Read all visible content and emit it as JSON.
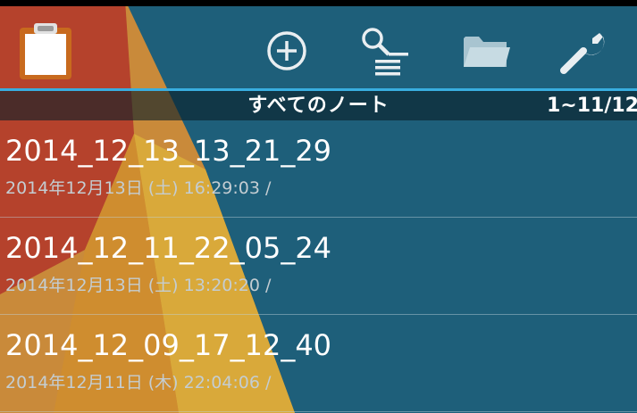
{
  "header": {
    "toolbar": [
      {
        "id": "add",
        "icon": "plus-circle-icon"
      },
      {
        "id": "search",
        "icon": "search-list-icon"
      },
      {
        "id": "folder",
        "icon": "folder-icon"
      },
      {
        "id": "settings",
        "icon": "wrench-icon"
      }
    ],
    "app_icon": "clipboard-icon"
  },
  "subbar": {
    "title": "すべてのノート",
    "count": "1~11/12"
  },
  "notes": [
    {
      "title": "2014_12_13_13_21_29",
      "meta": "2014年12月13日 (土) 16:29:03  /"
    },
    {
      "title": "2014_12_11_22_05_24",
      "meta": "2014年12月13日 (土) 13:20:20  /"
    },
    {
      "title": "2014_12_09_17_12_40",
      "meta": "2014年12月11日 (木) 22:04:06  /"
    }
  ],
  "colors": {
    "accent": "#39aee0",
    "background": "#1e5f7a",
    "wallpaper_red": "#b5422c",
    "wallpaper_yellow": "#d9a93a"
  }
}
